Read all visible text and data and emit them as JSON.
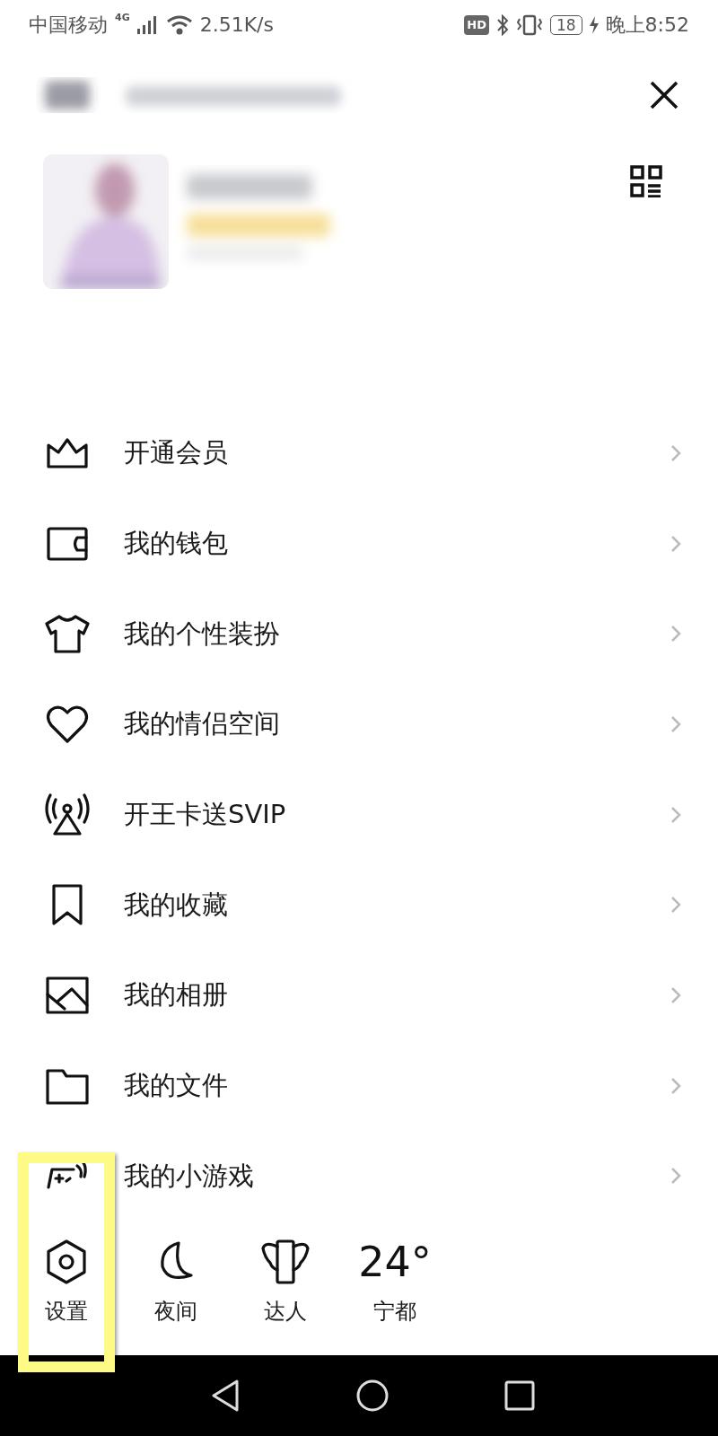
{
  "status_bar": {
    "carrier": "中国移动",
    "network": "4G",
    "speed": "2.51K/s",
    "hd": "HD",
    "battery": "18",
    "time": "晚上8:52"
  },
  "menu": [
    {
      "label": "开通会员"
    },
    {
      "label": "我的钱包"
    },
    {
      "label": "我的个性装扮"
    },
    {
      "label": "我的情侣空间"
    },
    {
      "label": "开王卡送SVIP"
    },
    {
      "label": "我的收藏"
    },
    {
      "label": "我的相册"
    },
    {
      "label": "我的文件"
    },
    {
      "label": "我的小游戏"
    }
  ],
  "shortcuts": [
    {
      "kind": "settings",
      "label": "设置",
      "highlighted": true
    },
    {
      "kind": "night",
      "label": "夜间",
      "highlighted": false
    },
    {
      "kind": "expert",
      "label": "达人",
      "highlighted": false
    },
    {
      "kind": "weather",
      "temp": "24°",
      "label": "宁都",
      "highlighted": false
    }
  ]
}
